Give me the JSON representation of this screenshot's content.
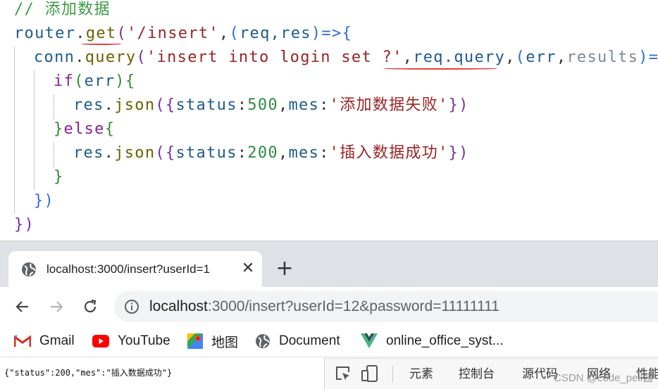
{
  "code": {
    "comment": "// 添加数据",
    "l1": {
      "obj": "router",
      "dot": ".",
      "fn": "get",
      "open": "(",
      "path": "'/insert'",
      "comma": ",",
      "p_open": "(",
      "params": "req,res",
      "p_close": ")",
      "arrow": "=>",
      "brace": "{"
    },
    "l2": {
      "obj": "conn",
      "dot": ".",
      "fn": "query",
      "open": "(",
      "sql": "'insert into login set ?'",
      "comma": ",",
      "arg": "req.query",
      "comma2": ",",
      "p_open": "(",
      "p1": "err",
      "p_comma": ",",
      "p2": "results",
      "p_close": ")",
      "arrow": "=>",
      "brace": "{"
    },
    "l3": {
      "kw": "if",
      "open": "(",
      "arg": "err",
      "close": ")",
      "brace": "{"
    },
    "l4": {
      "obj": "res",
      "dot": ".",
      "fn": "json",
      "open": "({",
      "key1": "status",
      "colon1": ":",
      "val1": "500",
      "comma": ",",
      "key2": "mes",
      "colon2": ":",
      "val2": "'添加数据失败'",
      "close": "})"
    },
    "l5": {
      "close": "}",
      "kw": "else",
      "open": "{"
    },
    "l6": {
      "obj": "res",
      "dot": ".",
      "fn": "json",
      "open": "({",
      "key1": "status",
      "colon1": ":",
      "val1": "200",
      "comma": ",",
      "key2": "mes",
      "colon2": ":",
      "val2": "'插入数据成功'",
      "close": "})"
    },
    "l7": "}",
    "l8": "})",
    "l9": "})"
  },
  "browser": {
    "tab_title": "localhost:3000/insert?userId=1",
    "tab_close": "✕",
    "new_tab": "+",
    "url_host": "localhost",
    "url_rest": ":3000/insert?userId=12&password=11111111",
    "bookmarks": [
      {
        "label": "Gmail",
        "icon": "gmail-icon"
      },
      {
        "label": "YouTube",
        "icon": "youtube-icon"
      },
      {
        "label": "地图",
        "icon": "maps-icon"
      },
      {
        "label": "Document",
        "icon": "globe-icon"
      },
      {
        "label": "online_office_syst...",
        "icon": "vue-icon"
      }
    ],
    "page_content": "{\"status\":200,\"mes\":\"插入数据成功\"}"
  },
  "devtools": {
    "tabs": [
      "元素",
      "控制台",
      "源代码",
      "网络",
      "性能"
    ]
  },
  "watermark": "CSDN @code_peil酱",
  "colors": {
    "underline": "#e23d3d",
    "tabstrip": "#dee1e6",
    "omnibox": "#f1f3f4"
  }
}
